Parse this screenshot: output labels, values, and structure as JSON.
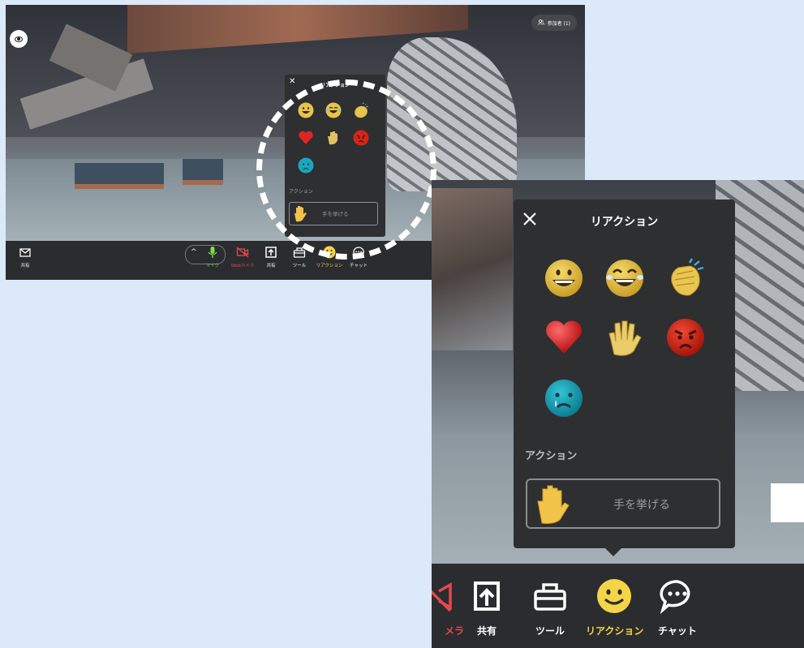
{
  "small_view": {
    "participants_label": "参加者 (1)",
    "toolbar": {
      "share_left_label": "共有",
      "mic_label": "マイク",
      "webcam_label": "Webカメラ",
      "share_label": "共有",
      "tools_label": "ツール",
      "reaction_label": "リアクション",
      "chat_label": "チャット"
    },
    "reaction_panel": {
      "title": "リアクション",
      "action_header": "アクション",
      "raise_hand_label": "手を挙げる"
    }
  },
  "zoom_view": {
    "reaction_panel": {
      "title": "リアクション",
      "emojis": [
        "grinning-face",
        "laughing-tears-face",
        "clapping-hands",
        "red-heart",
        "waving-hand",
        "angry-face",
        "crying-face"
      ],
      "action_header": "アクション",
      "raise_hand_label": "手を挙げる"
    },
    "toolbar": {
      "camera_partial_label": "メラ",
      "share_label": "共有",
      "tools_label": "ツール",
      "reaction_label": "リアクション",
      "chat_label": "チャット"
    }
  },
  "colors": {
    "page_bg": "#dbe9f8",
    "panel_bg": "#2e2f31",
    "toolbar_bg": "#2b2c2f",
    "mic_green": "#7fdc4f",
    "webcam_red": "#e5484d",
    "reaction_yellow": "#f4d547"
  }
}
